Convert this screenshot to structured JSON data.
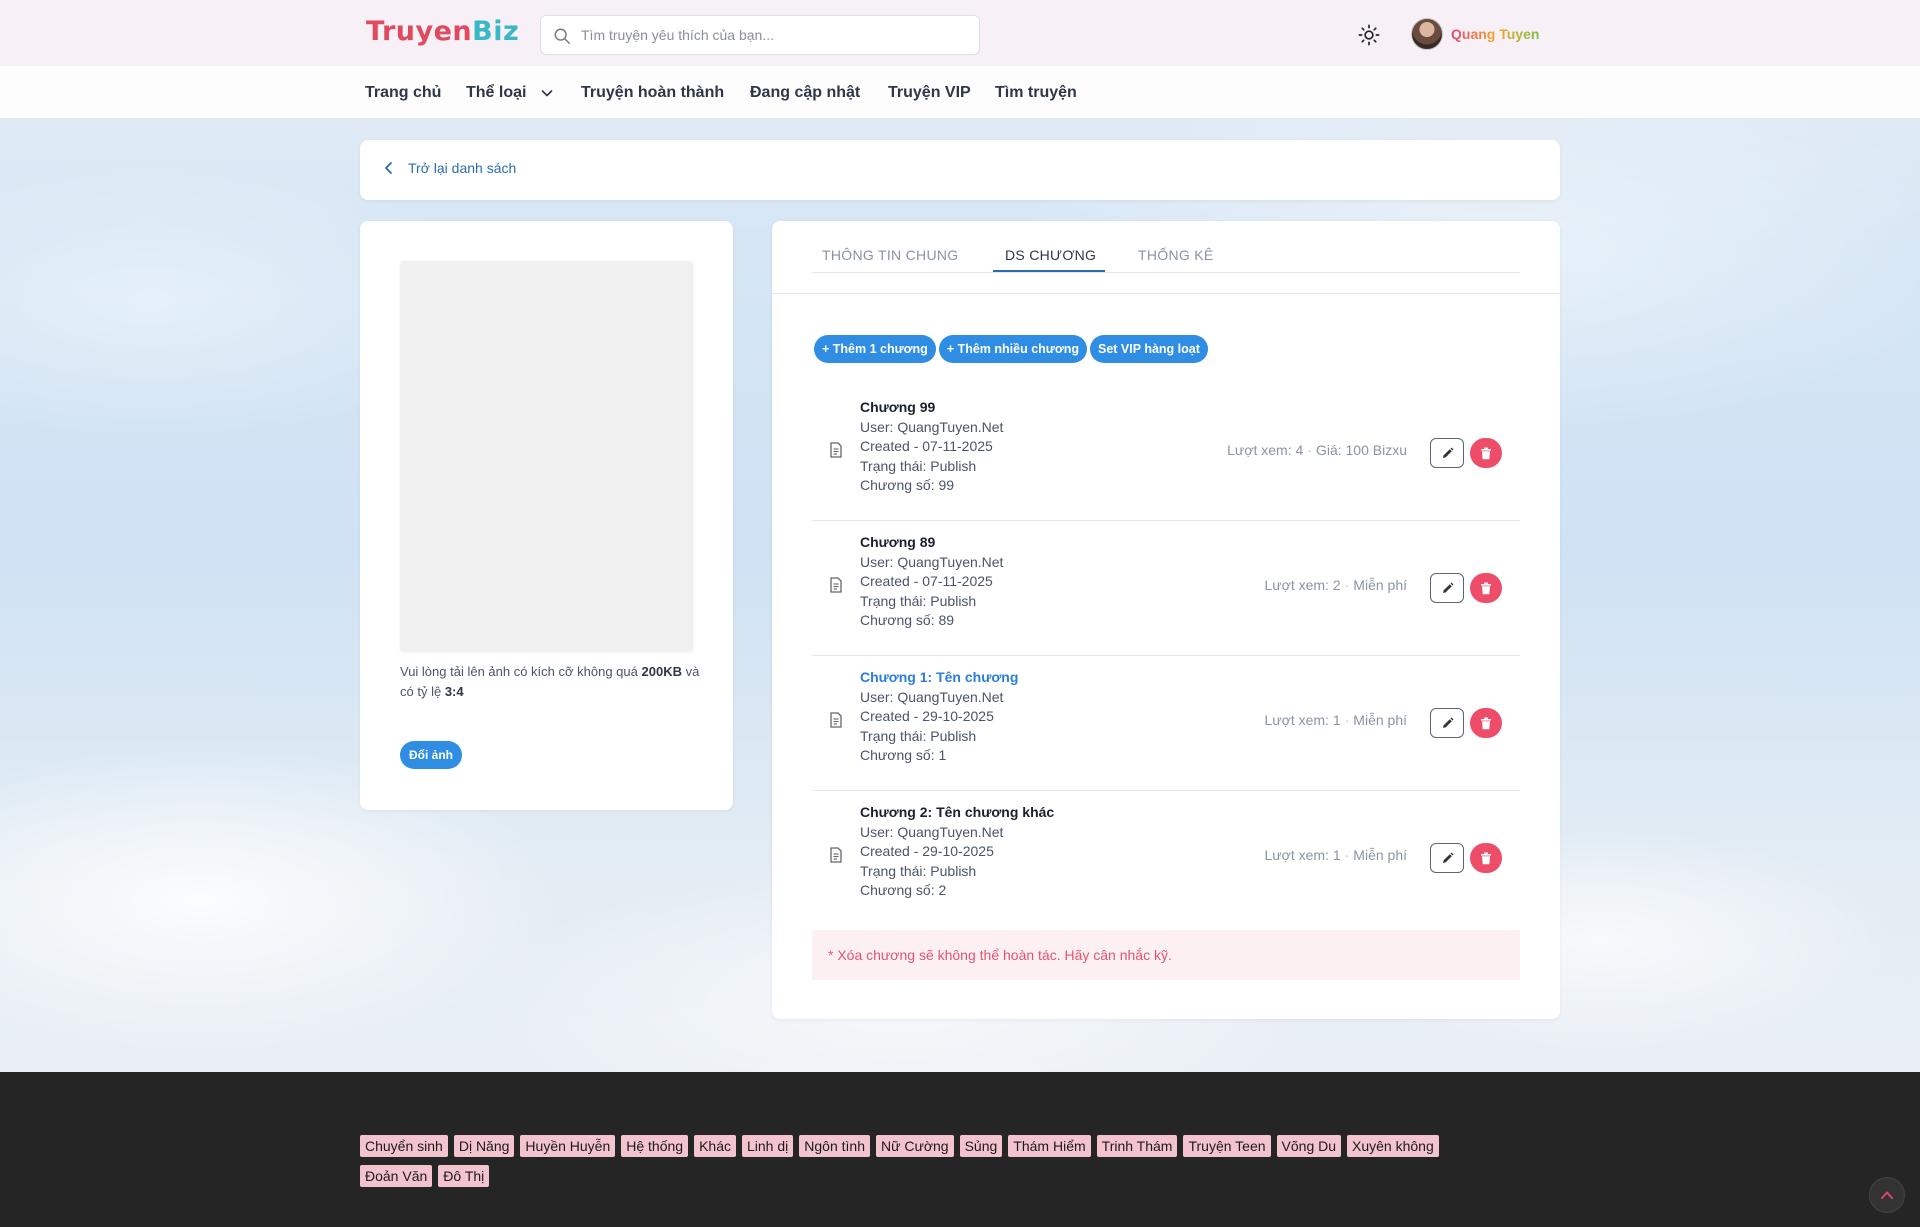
{
  "header": {
    "logo_part1": "Truyen",
    "logo_part2": "Biz",
    "search_placeholder": "Tìm truyện yêu thích của bạn...",
    "username": "Quang Tuyen"
  },
  "nav": {
    "items": [
      {
        "label": "Trang chủ"
      },
      {
        "label": "Thể loại"
      },
      {
        "label": "Truyện hoàn thành"
      },
      {
        "label": "Đang cập nhật"
      },
      {
        "label": "Truyện VIP"
      },
      {
        "label": "Tìm truyện"
      }
    ]
  },
  "back": {
    "label": "Trở lại danh sách"
  },
  "cover": {
    "note_prefix": "Vui lòng tải lên ảnh có kích cỡ không quá",
    "note_size": "200KB",
    "note_mid": "và có tỷ lệ",
    "note_ratio": "3:4",
    "change_label": "Đổi ảnh"
  },
  "tabs": [
    {
      "label": "THÔNG TIN CHUNG"
    },
    {
      "label": "DS CHƯƠNG",
      "active": true
    },
    {
      "label": "THỐNG KÊ"
    }
  ],
  "actions": {
    "add_one": "+ Thêm 1 chương",
    "add_many": "+ Thêm nhiều chương",
    "set_vip": "Set VIP hàng loạt"
  },
  "chapters": [
    {
      "title": "Chương 99",
      "user": "User: QuangTuyen.Net",
      "created": "Created - 07-11-2025",
      "status": "Trạng thái: Publish",
      "number": "Chương số: 99",
      "views": "Lượt xem: 4",
      "price": "Giá: 100 Bizxu"
    },
    {
      "title": "Chương 89",
      "user": "User: QuangTuyen.Net",
      "created": "Created - 07-11-2025",
      "status": "Trạng thái: Publish",
      "number": "Chương số: 89",
      "views": "Lượt xem: 2",
      "price": "Miễn phí"
    },
    {
      "title": "Chương 1: Tên chương",
      "user": "User: QuangTuyen.Net",
      "created": "Created - 29-10-2025",
      "status": "Trạng thái: Publish",
      "number": "Chương số: 1",
      "views": "Lượt xem: 1",
      "price": "Miễn phí"
    },
    {
      "title": "Chương 2: Tên chương khác",
      "user": "User: QuangTuyen.Net",
      "created": "Created - 29-10-2025",
      "status": "Trạng thái: Publish",
      "number": "Chương số: 2",
      "views": "Lượt xem: 1",
      "price": "Miễn phí"
    }
  ],
  "warning": "* Xóa chương sẽ không thể hoàn tác. Hãy cân nhắc kỹ.",
  "footer_tags": [
    "Chuyển sinh",
    "Dị Năng",
    "Huyền Huyễn",
    "Hệ thống",
    "Khác",
    "Linh dị",
    "Ngôn tình",
    "Nữ Cường",
    "Sủng",
    "Thám Hiểm",
    "Trinh Thám",
    "Truyện Teen",
    "Võng Du",
    "Xuyên không",
    "Đoản Văn",
    "Đô Thị"
  ],
  "colors": {
    "accent_blue": "#2f8de4",
    "danger": "#ee4d6a",
    "tag_bg": "#f3c4cd",
    "footer_bg": "#252525"
  },
  "icons": [
    "search-icon",
    "sun-icon",
    "chevron-down-icon",
    "chevron-left-icon",
    "document-icon",
    "pencil-icon",
    "trash-icon",
    "chevron-up-icon"
  ]
}
